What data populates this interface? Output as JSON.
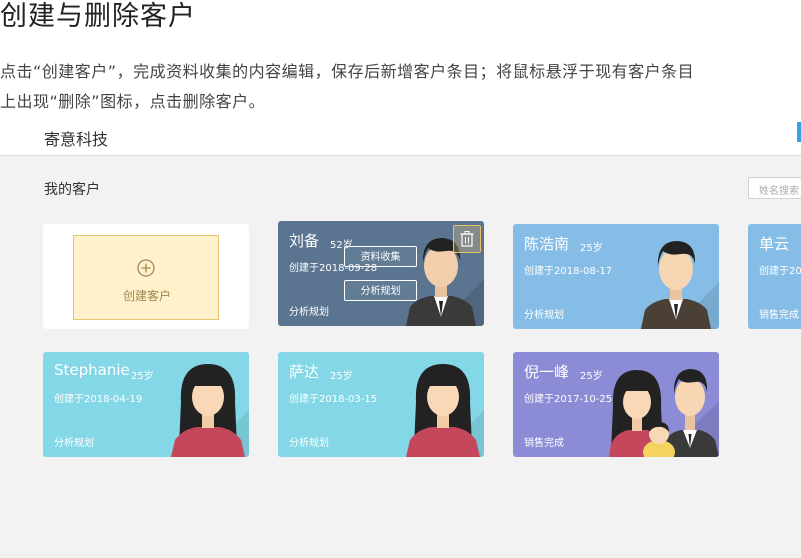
{
  "header": {
    "title": "创建与删除客户",
    "desc_line1": "点击“创建客户”，完成资料收集的内容编辑，保存后新增客户条目；将鼠标悬浮于现有客户条目",
    "desc_line2": "上出现“删除”图标，点击删除客户。"
  },
  "app": {
    "brand": "寄意科技",
    "section_title": "我的客户",
    "search_placeholder": "姓名搜索",
    "create_label": "创建客户",
    "hover_actions": {
      "collect": "资料收集",
      "plan": "分析规划"
    }
  },
  "customers": [
    {
      "name": "刘备",
      "age": "52岁",
      "created": "创建于2018-09-28",
      "status": "分析规划",
      "color": "#5b7591",
      "hovered": true,
      "avatar": "male"
    },
    {
      "name": "陈浩南",
      "age": "25岁",
      "created": "创建于2018-08-17",
      "status": "分析规划",
      "color": "#86bde7",
      "avatar": "male"
    },
    {
      "name": "单云",
      "age": "",
      "created": "创建于20",
      "status": "销售完成",
      "color": "#86bde7",
      "avatar": "male"
    },
    {
      "name": "Stephanie",
      "age": "25岁",
      "created": "创建于2018-04-19",
      "status": "分析规划",
      "color": "#83d7e6",
      "avatar": "female"
    },
    {
      "name": "萨达",
      "age": "25岁",
      "created": "创建于2018-03-15",
      "status": "分析规划",
      "color": "#83d7e6",
      "avatar": "female"
    },
    {
      "name": "倪一峰",
      "age": "25岁",
      "created": "创建于2017-10-25",
      "status": "销售完成",
      "color": "#8c8bd6",
      "avatar": "family"
    }
  ],
  "colors": {
    "accent": "#3aa0e0",
    "create_bg": "#fff1cc",
    "create_border": "#e8c56a"
  }
}
